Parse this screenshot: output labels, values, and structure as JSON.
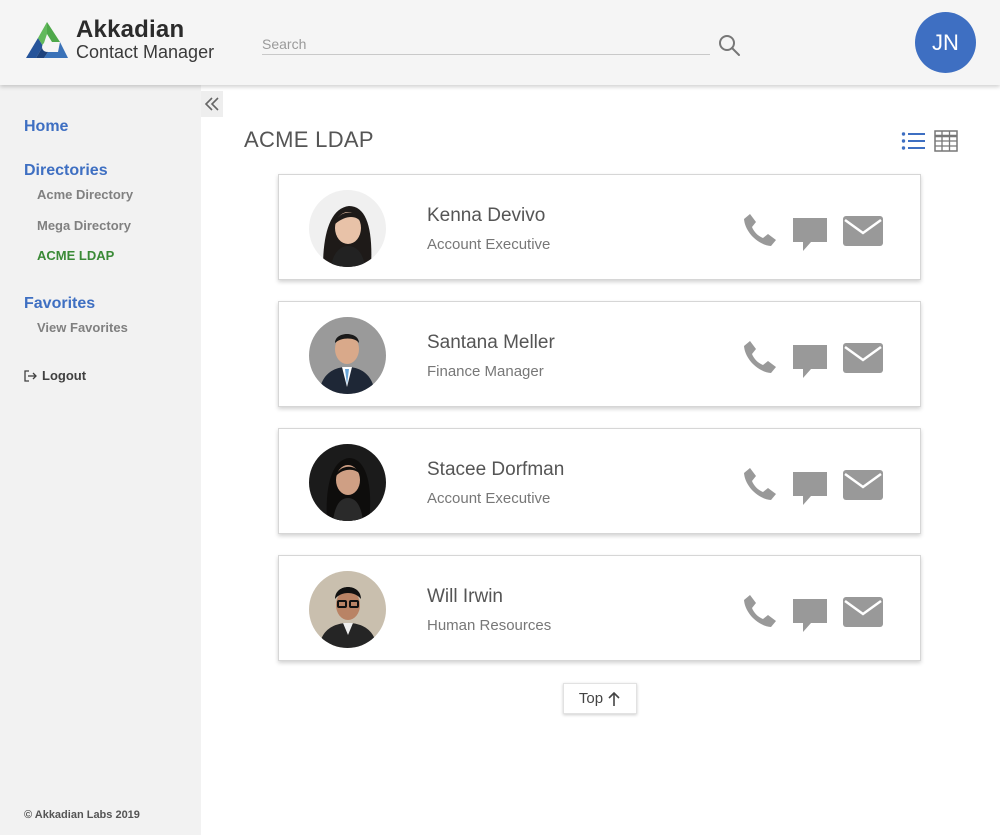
{
  "header": {
    "brand_title": "Akkadian",
    "brand_subtitle": "Contact Manager",
    "search_placeholder": "Search",
    "user_initials": "JN",
    "avatar_color": "#3e6fc2"
  },
  "sidebar": {
    "home_label": "Home",
    "directories_heading": "Directories",
    "directories": [
      {
        "label": "Acme Directory",
        "active": false
      },
      {
        "label": "Mega Directory",
        "active": false
      },
      {
        "label": "ACME LDAP",
        "active": true
      }
    ],
    "favorites_heading": "Favorites",
    "favorites": [
      {
        "label": "View Favorites"
      }
    ],
    "logout_label": "Logout",
    "copyright": "© Akkadian Labs 2019",
    "collapse_icon": "double-chevron-left-icon"
  },
  "main": {
    "title": "ACME LDAP",
    "view_icons": [
      "list-view-icon",
      "grid-view-icon"
    ],
    "contacts": [
      {
        "name": "Kenna Devivo",
        "title": "Account Executive"
      },
      {
        "name": "Santana Meller",
        "title": "Finance Manager"
      },
      {
        "name": "Stacee Dorfman",
        "title": "Account Executive"
      },
      {
        "name": "Will Irwin",
        "title": "Human Resources"
      }
    ],
    "action_icons": [
      "phone-icon",
      "chat-icon",
      "mail-icon"
    ],
    "top_button_label": "Top"
  },
  "colors": {
    "accent_blue": "#3e6fc2",
    "active_green": "#3a8a36",
    "icon_gray": "#999999"
  }
}
